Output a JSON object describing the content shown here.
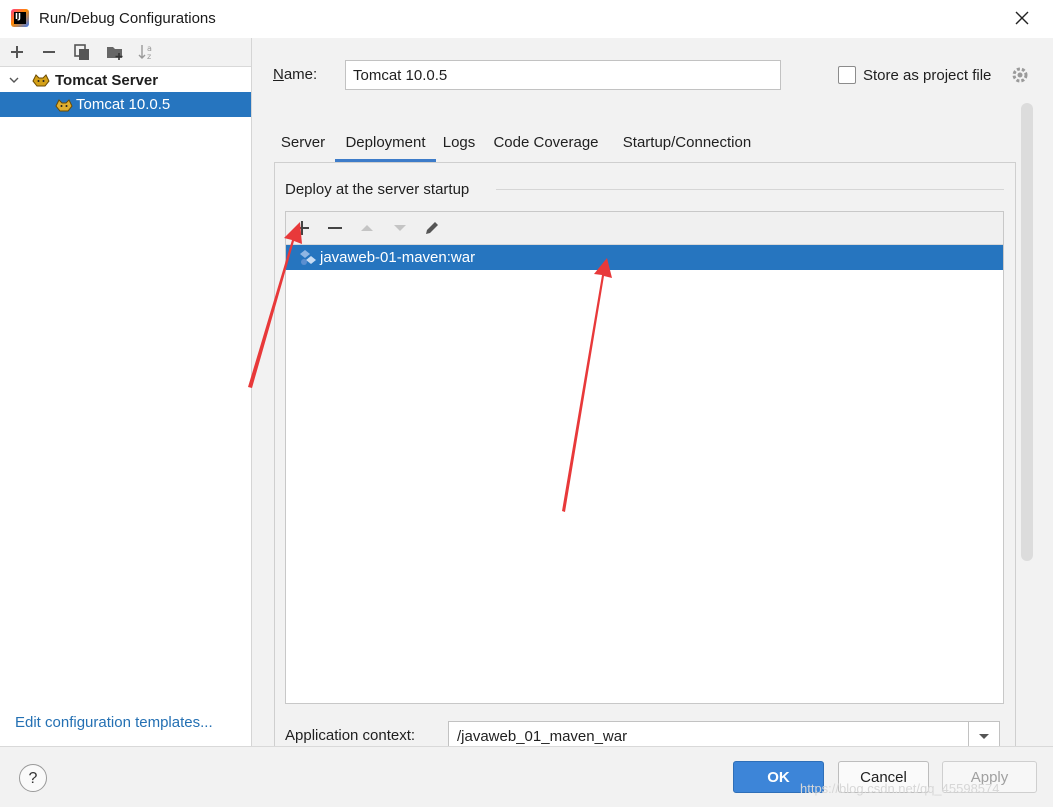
{
  "window": {
    "title": "Run/Debug Configurations"
  },
  "sidebar": {
    "tree": {
      "group_label": "Tomcat Server",
      "selected_item": "Tomcat 10.0.5"
    },
    "edit_templates_link": "Edit configuration templates..."
  },
  "form": {
    "name_label": "Name:",
    "name_value": "Tomcat 10.0.5",
    "store_label": "Store as project file",
    "store_checked": false
  },
  "tabs": [
    {
      "label": "Server",
      "active": false
    },
    {
      "label": "Deployment",
      "active": true
    },
    {
      "label": "Logs",
      "active": false
    },
    {
      "label": "Code Coverage",
      "active": false
    },
    {
      "label": "Startup/Connection",
      "active": false
    }
  ],
  "deployment": {
    "section_title": "Deploy at the server startup",
    "artifacts": [
      "javaweb-01-maven:war"
    ],
    "app_context_label": "Application context:",
    "app_context_value": "/javaweb_01_maven_war"
  },
  "buttons": {
    "ok": "OK",
    "cancel": "Cancel",
    "apply": "Apply",
    "help": "?"
  },
  "watermark": "https://blog.csdn.net/qq_45598574",
  "colors": {
    "selection": "#2675bf",
    "accent": "#3d85d8",
    "link": "#2470b3",
    "annotation_arrow": "#e8393a"
  }
}
